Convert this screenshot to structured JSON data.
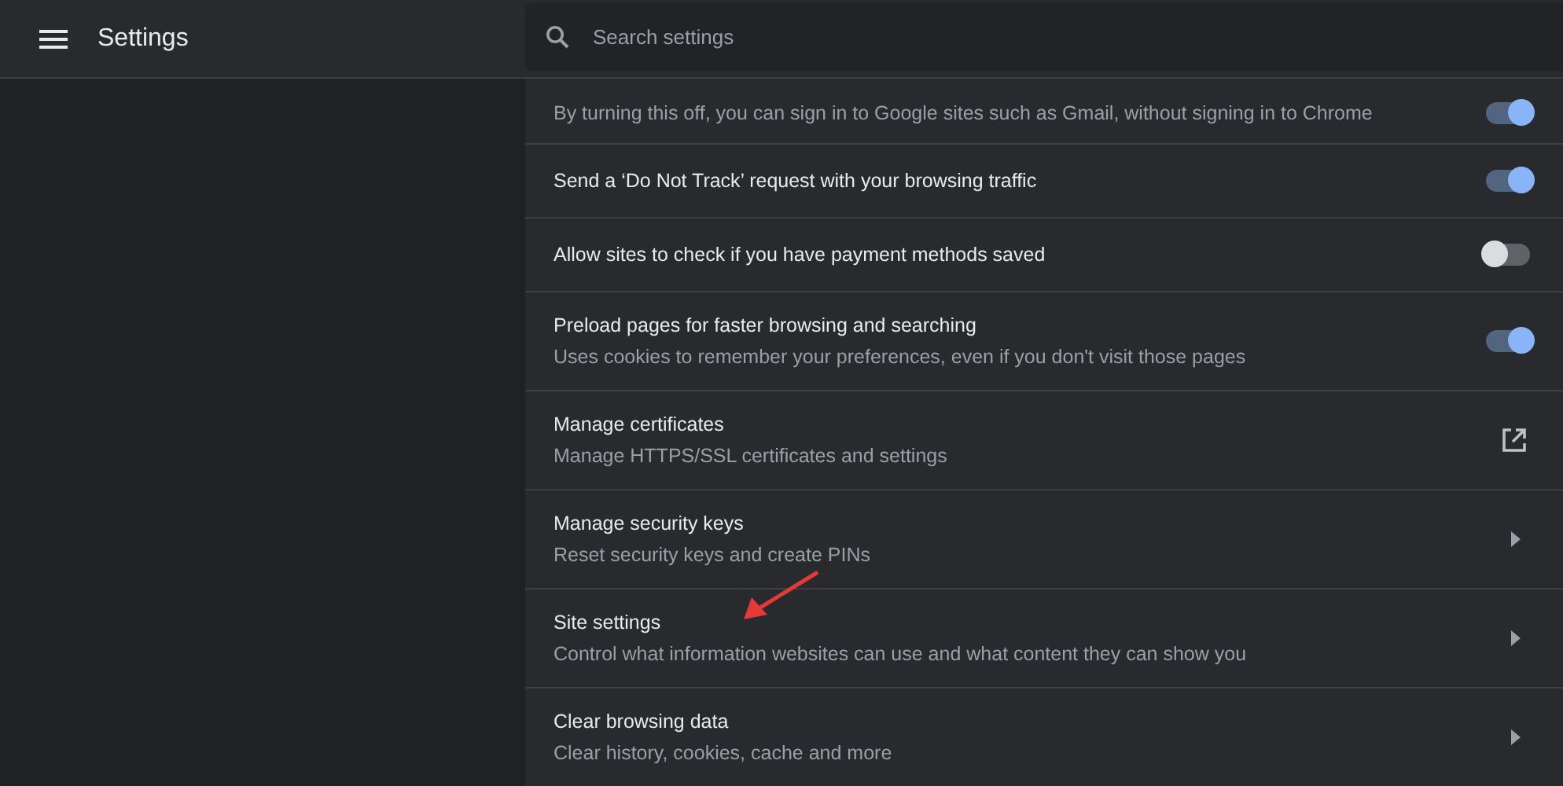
{
  "header": {
    "title": "Settings"
  },
  "search": {
    "placeholder": "Search settings"
  },
  "rows": [
    {
      "kind": "toggle",
      "description": "By turning this off, you can sign in to Google sites such as Gmail, without signing in to Chrome",
      "on": true
    },
    {
      "kind": "toggle",
      "title": "Send a ‘Do Not Track’ request with your browsing traffic",
      "on": true
    },
    {
      "kind": "toggle",
      "title": "Allow sites to check if you have payment methods saved",
      "on": false
    },
    {
      "kind": "toggle",
      "title": "Preload pages for faster browsing and searching",
      "description": "Uses cookies to remember your preferences, even if you don't visit those pages",
      "on": true
    },
    {
      "kind": "external",
      "title": "Manage certificates",
      "description": "Manage HTTPS/SSL certificates and settings"
    },
    {
      "kind": "submenu",
      "title": "Manage security keys",
      "description": "Reset security keys and create PINs"
    },
    {
      "kind": "submenu",
      "title": "Site settings",
      "description": "Control what information websites can use and what content they can show you"
    },
    {
      "kind": "submenu",
      "title": "Clear browsing data",
      "description": "Clear history, cookies, cache and more"
    }
  ]
}
